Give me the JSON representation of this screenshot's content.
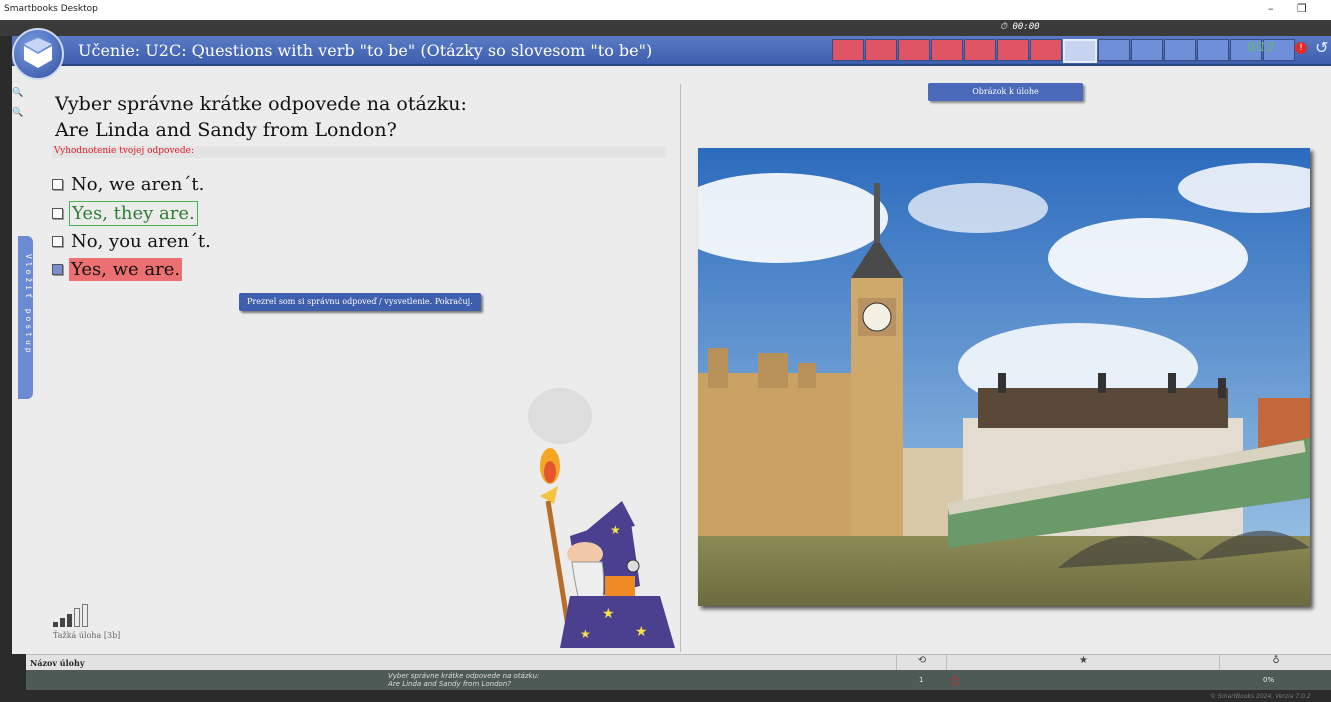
{
  "window": {
    "title": "Smartbooks Desktop",
    "minimize": "–",
    "maximize": "❐"
  },
  "timer": "00:00",
  "header": {
    "title": "Učenie: U2C: Questions with verb \"to be\" (Otázky so slovesom \"to be\")",
    "progress": {
      "wrong": 7,
      "current": 1,
      "remaining": 6,
      "counter": "0/13"
    },
    "colors": {
      "wrong": "#e05565",
      "pending": "#6f8fd8",
      "accent": "#3e5fae"
    }
  },
  "task": {
    "line1": "Vyber správne krátke odpovede na otázku:",
    "line2": "Are Linda and Sandy from London?",
    "evaluation_label": "Vyhodnotenie tvojej odpovede:",
    "options": [
      {
        "text": "No, we aren´t.",
        "state": "none"
      },
      {
        "text": "Yes, they are.",
        "state": "correct"
      },
      {
        "text": "No, you aren´t.",
        "state": "none"
      },
      {
        "text": "Yes, we are.",
        "state": "wrong"
      }
    ],
    "continue_button": "Prezrel som si správnu odpoveď / vysvetlenie. Pokračuj.",
    "side_tab": "Vložiť postup",
    "difficulty_label": "Ťažká úloha  [3b]",
    "difficulty_level": 3
  },
  "image_button": "Obrázok k úlohe",
  "infobar": {
    "name_label": "Názov úlohy",
    "icons": [
      "refresh-icon",
      "star-icon",
      "bulb-icon"
    ]
  },
  "footer": {
    "question_line1": "Vyber správne krátke odpovede na otázku:",
    "question_line2": "Are Linda and Sandy from London?",
    "count": "1",
    "percent": "0%"
  },
  "version": "© SmartBooks 2024, Verzia 7.0.2"
}
